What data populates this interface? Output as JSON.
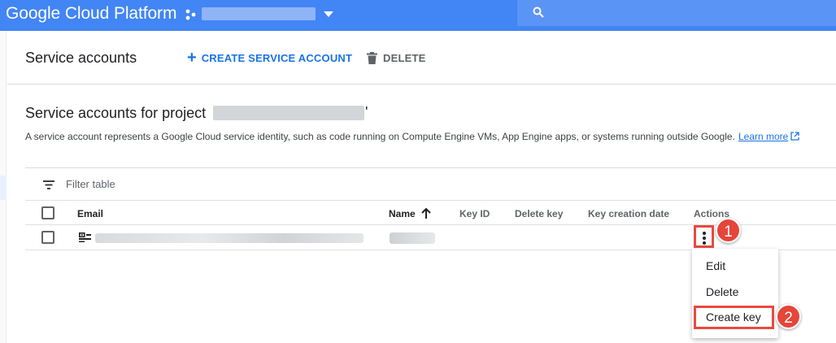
{
  "topbar": {
    "brand": "Google Cloud Platform",
    "project_icon": "project-dots-icon",
    "search_icon": "search-icon"
  },
  "header": {
    "title": "Service accounts",
    "create_label": "CREATE SERVICE ACCOUNT",
    "delete_label": "DELETE"
  },
  "section": {
    "title": "Service accounts for project",
    "quote": "'",
    "description": "A service account represents a Google Cloud service identity, such as code running on Compute Engine VMs, App Engine apps, or systems running outside Google.",
    "learn_more": "Learn more"
  },
  "filter": {
    "placeholder": "Filter table"
  },
  "table": {
    "columns": [
      "Email",
      "Name",
      "Key ID",
      "Delete key",
      "Key creation date",
      "Actions"
    ],
    "sort_column": "Name",
    "sort_direction": "ascending"
  },
  "menu": {
    "items": [
      "Edit",
      "Delete",
      "Create key"
    ],
    "highlighted": "Create key"
  },
  "callouts": [
    "1",
    "2"
  ],
  "colors": {
    "topbar": "#4285f4",
    "accent": "#1a73e8",
    "highlight": "#e84a3f"
  }
}
